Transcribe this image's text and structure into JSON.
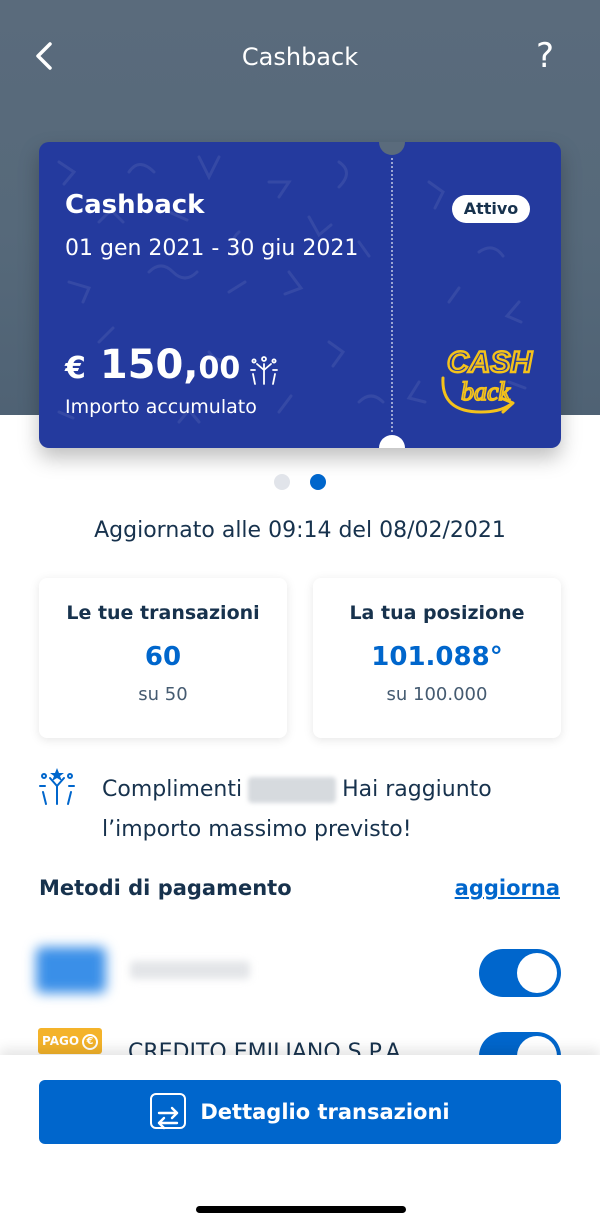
{
  "header": {
    "title": "Cashback",
    "help_label": "?"
  },
  "card": {
    "title": "Cashback",
    "period": "01 gen 2021 - 30 giu 2021",
    "status": "Attivo",
    "currency": "€",
    "amount_int": "150,",
    "amount_dec": "00",
    "amount_label": "Importo accumulato",
    "logo_text_top": "CASH",
    "logo_text_bottom": "back",
    "colors": {
      "bg": "#243a9e",
      "logo": "#f4c21b"
    }
  },
  "pager": {
    "count": 2,
    "active_index": 1
  },
  "updated_text": "Aggiornato alle 09:14 del 08/02/2021",
  "stats": {
    "transactions": {
      "title": "Le tue transazioni",
      "value": "60",
      "sub": "su 50"
    },
    "position": {
      "title": "La tua posizione",
      "value": "101.088°",
      "sub": "su 100.000"
    }
  },
  "congrats": {
    "prefix": "Complimenti",
    "suffix": "Hai raggiunto l’importo massimo previsto!"
  },
  "payment_methods": {
    "title": "Metodi di pagamento",
    "update_link": "aggiorna",
    "items": [
      {
        "name": "",
        "enabled": true
      },
      {
        "logo": "PAGO",
        "name": "CREDITO EMILIANO S.P.A",
        "enabled": true
      }
    ]
  },
  "cta": {
    "label": "Dettaglio transazioni"
  },
  "colors": {
    "accent": "#0066cc",
    "text": "#17324d"
  }
}
